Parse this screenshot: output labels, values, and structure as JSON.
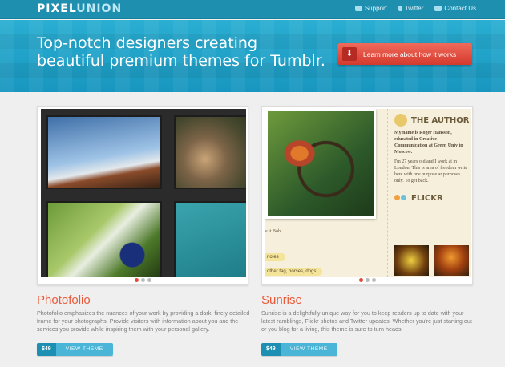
{
  "header": {
    "logo_left": "PIXEL",
    "logo_right": "UNION",
    "nav": [
      {
        "label": "Support",
        "icon": "chat-bubble-icon"
      },
      {
        "label": "Twitter",
        "icon": "twitter-icon"
      },
      {
        "label": "Contact Us",
        "icon": "mail-icon"
      }
    ]
  },
  "hero": {
    "headline": "Top-notch designers creating beautiful premium themes for Tumblr.",
    "cta_label": "Learn more about how it works",
    "cta_icon": "down-arrow-icon"
  },
  "themes": [
    {
      "name": "Photofolio",
      "description": "Photofolio emphasizes the nuances of your work by providing a dark, finely detailed frame for your photographs. Provide visitors with information about you and the services you provide while inspiring them with your personal gallery.",
      "price": "$49",
      "button_label": "VIEW THEME",
      "active_dot": 0
    },
    {
      "name": "Sunrise",
      "description": "Sunrise is a delightfully unique way for you to keep readers up to date with your latest ramblings, Flickr photos and Twitter updates. Whether you're just starting out or you blog for a living, this theme is sure to turn heads.",
      "price": "$49",
      "button_label": "VIEW THEME",
      "active_dot": 0,
      "preview": {
        "author_heading": "THE AUTHOR",
        "author_intro": "My name is Roger Hansson, educated in Creative Communication at Green Univ in Moscow.",
        "author_body": "I'm 27 years old and I work at in London. This is area of freedom write here with one purpose ar purposes only. To get back.",
        "flickr_heading": "FLICKR",
        "note_text": "e it Bob.",
        "tag1": "notes",
        "tag2": "other tag, horses, dogs"
      }
    }
  ],
  "colors": {
    "topbar": "#1f8fb0",
    "hero": "#22a3ca",
    "cta": "#e04a3c",
    "theme_title": "#e85a3a",
    "price_badge": "#1c8fb3"
  }
}
